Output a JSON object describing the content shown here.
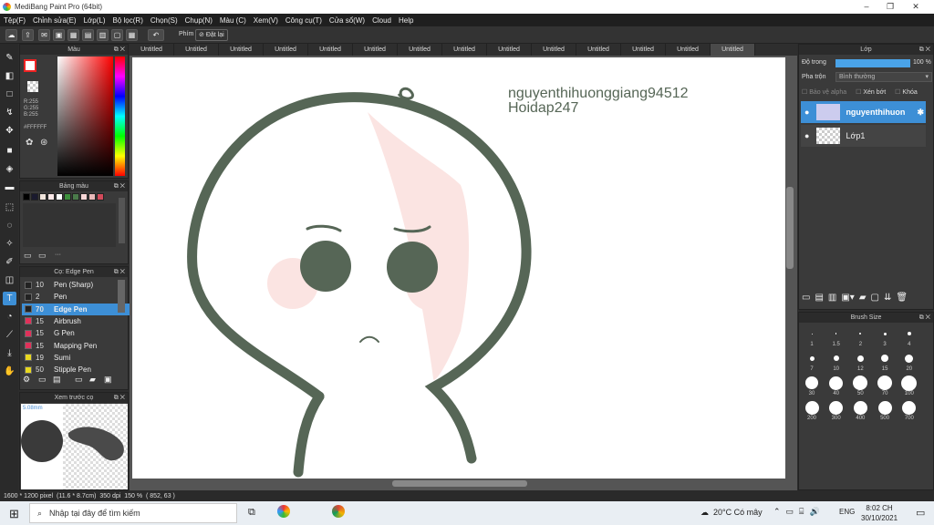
{
  "window": {
    "title": "MediBang Paint Pro (64bit)",
    "minimize": "–",
    "restore": "❐",
    "close": "✕"
  },
  "menu": [
    "Tệp(F)",
    "Chỉnh sửa(E)",
    "Lớp(L)",
    "Bộ lọc(R)",
    "Chọn(S)",
    "Chụp(N)",
    "Màu (C)",
    "Xem(V)",
    "Công cụ(T)",
    "Cửa sổ(W)",
    "Cloud",
    "Help"
  ],
  "toolbar": {
    "keys_label": "Phím",
    "reset_label": "Đặt lại"
  },
  "color_panel": {
    "title": "Màu",
    "r": "R:255",
    "g": "G:255",
    "b": "B:255",
    "hex": "#FFFFFF"
  },
  "palette_panel": {
    "title": "Bảng màu",
    "more": "···",
    "swatches": [
      "#000000",
      "#1a1a2e",
      "#f0e4dc",
      "#fbe8e8",
      "#ffffff",
      "#3c8f3c",
      "#4a7a4a",
      "#f6d6d6",
      "#e8b8b8",
      "#d14a5a"
    ]
  },
  "brush_panel": {
    "title": "Cọ: Edge Pen",
    "items": [
      {
        "size": "10",
        "name": "Pen (Sharp)",
        "color": "#222222"
      },
      {
        "size": "2",
        "name": "Pen",
        "color": "#222222"
      },
      {
        "size": "70",
        "name": "Edge Pen",
        "color": "#222222"
      },
      {
        "size": "15",
        "name": "Airbrush",
        "color": "#e0315a"
      },
      {
        "size": "15",
        "name": "G Pen",
        "color": "#e0315a"
      },
      {
        "size": "15",
        "name": "Mapping Pen",
        "color": "#e0315a"
      },
      {
        "size": "19",
        "name": "Sumi",
        "color": "#e8d820"
      },
      {
        "size": "50",
        "name": "Stipple Pen",
        "color": "#e8d820"
      }
    ]
  },
  "preview_panel": {
    "title": "Xem trước cọ",
    "size": "5.08mm"
  },
  "tabs": [
    "Untitled",
    "Untitled",
    "Untitled",
    "Untitled",
    "Untitled",
    "Untitled",
    "Untitled",
    "Untitled",
    "Untitled",
    "Untitled",
    "Untitled",
    "Untitled",
    "Untitled",
    "Untitled"
  ],
  "canvas": {
    "watermark_line1": "nguyenthihuonggiang94512",
    "watermark_line2": "Hoidap247",
    "stroke_color": "#566656",
    "blush_color": "#fbe4e2"
  },
  "layer_panel": {
    "title": "Lớp",
    "opacity_label": "Độ trong",
    "opacity_value": "100 %",
    "opacity": 1.0,
    "blend_label": "Pha trộn",
    "blend_value": "Bình thường",
    "protect_alpha": "Bảo vệ alpha",
    "clipping": "Xén bớt",
    "lock": "Khóa",
    "layers": [
      {
        "name": "nguyenthihuon",
        "selected": true
      },
      {
        "name": "Lớp1",
        "selected": false
      }
    ]
  },
  "brush_size_panel": {
    "title": "Brush Size",
    "sizes": [
      "1",
      "1.5",
      "2",
      "3",
      "4",
      "7",
      "10",
      "12",
      "15",
      "20",
      "30",
      "40",
      "50",
      "70",
      "100",
      "200",
      "300",
      "400",
      "500",
      "700"
    ]
  },
  "status": {
    "dimensions": "1600 * 1200 pixel",
    "physical": "(11.6 * 8.7cm)",
    "dpi": "350 dpi",
    "zoom": "150 %",
    "coords": "( 852, 63 )"
  },
  "taskbar": {
    "search_placeholder": "Nhập tại đây để tìm kiếm",
    "weather": "20°C  Có mây",
    "lang": "ENG",
    "time": "8:02 CH",
    "date": "30/10/2021"
  }
}
